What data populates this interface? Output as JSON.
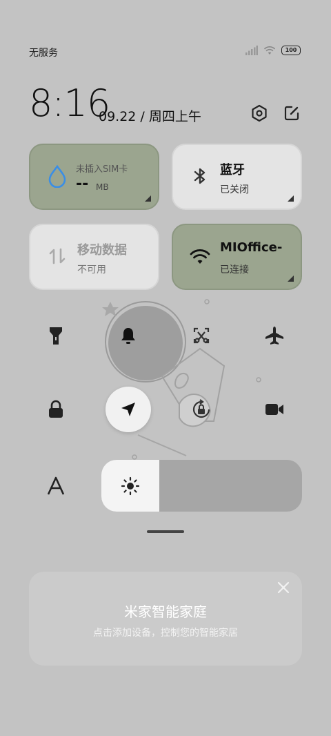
{
  "status_bar": {
    "carrier": "无服务",
    "battery": "100"
  },
  "header": {
    "time": "8:16",
    "date": "09.22 / 周四上午"
  },
  "tiles": {
    "sim": {
      "title": "未插入SIM卡",
      "value": "--",
      "unit": "MB"
    },
    "bluetooth": {
      "title": "蓝牙",
      "status": "已关闭"
    },
    "mobile_data": {
      "title": "移动数据",
      "status": "不可用"
    },
    "wifi": {
      "title": "MIOffice-",
      "status": "已连接"
    }
  },
  "icons": {
    "settings": "settings-icon",
    "edit": "edit-icon",
    "flashlight": "flashlight-icon",
    "bell": "bell-icon",
    "screenshot": "screenshot-icon",
    "airplane": "airplane-icon",
    "lock": "lock-icon",
    "location": "location-icon",
    "rotation": "rotation-lock-icon",
    "video": "video-camera-icon",
    "font": "font-icon",
    "brightness": "sun-icon"
  },
  "brightness": {
    "level": 0.29
  },
  "smart_home": {
    "title": "米家智能家庭",
    "subtitle": "点击添加设备，控制您的智能家居"
  },
  "colors": {
    "background": "#c3c3c3",
    "tile_active": "#9ba58f",
    "tile_inactive": "#e4e4e4",
    "accent_drop": "#3a8ee6"
  }
}
